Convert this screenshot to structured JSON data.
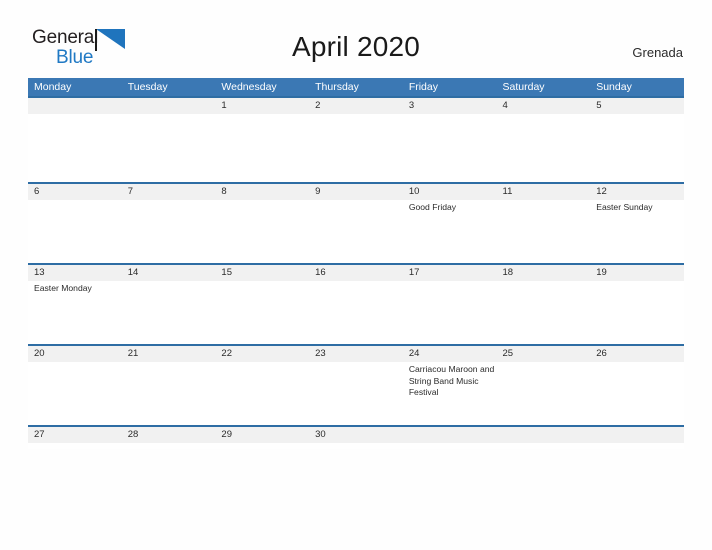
{
  "brand": {
    "word_one": "General",
    "word_two": "Blue",
    "flag_icon": "blue-flag-triangle",
    "blue": "#2079c4"
  },
  "header": {
    "title": "April 2020",
    "region": "Grenada"
  },
  "colors": {
    "weekday_header_bg": "#3b78b4",
    "week_divider": "#2e6da4",
    "date_band_bg": "#f1f1f1",
    "page_bg": "#fefefe",
    "text": "#2b2b2b"
  },
  "calendar": {
    "weekdays": [
      "Monday",
      "Tuesday",
      "Wednesday",
      "Thursday",
      "Friday",
      "Saturday",
      "Sunday"
    ],
    "weeks": [
      {
        "days": [
          {
            "num": "",
            "event": ""
          },
          {
            "num": "",
            "event": ""
          },
          {
            "num": "1",
            "event": ""
          },
          {
            "num": "2",
            "event": ""
          },
          {
            "num": "3",
            "event": ""
          },
          {
            "num": "4",
            "event": ""
          },
          {
            "num": "5",
            "event": ""
          }
        ]
      },
      {
        "days": [
          {
            "num": "6",
            "event": ""
          },
          {
            "num": "7",
            "event": ""
          },
          {
            "num": "8",
            "event": ""
          },
          {
            "num": "9",
            "event": ""
          },
          {
            "num": "10",
            "event": "Good Friday"
          },
          {
            "num": "11",
            "event": ""
          },
          {
            "num": "12",
            "event": "Easter Sunday"
          }
        ]
      },
      {
        "days": [
          {
            "num": "13",
            "event": "Easter Monday"
          },
          {
            "num": "14",
            "event": ""
          },
          {
            "num": "15",
            "event": ""
          },
          {
            "num": "16",
            "event": ""
          },
          {
            "num": "17",
            "event": ""
          },
          {
            "num": "18",
            "event": ""
          },
          {
            "num": "19",
            "event": ""
          }
        ]
      },
      {
        "days": [
          {
            "num": "20",
            "event": ""
          },
          {
            "num": "21",
            "event": ""
          },
          {
            "num": "22",
            "event": ""
          },
          {
            "num": "23",
            "event": ""
          },
          {
            "num": "24",
            "event": "Carriacou Maroon and String Band Music Festival"
          },
          {
            "num": "25",
            "event": ""
          },
          {
            "num": "26",
            "event": ""
          }
        ]
      },
      {
        "days": [
          {
            "num": "27",
            "event": ""
          },
          {
            "num": "28",
            "event": ""
          },
          {
            "num": "29",
            "event": ""
          },
          {
            "num": "30",
            "event": ""
          },
          {
            "num": "",
            "event": ""
          },
          {
            "num": "",
            "event": ""
          },
          {
            "num": "",
            "event": ""
          }
        ]
      }
    ]
  }
}
